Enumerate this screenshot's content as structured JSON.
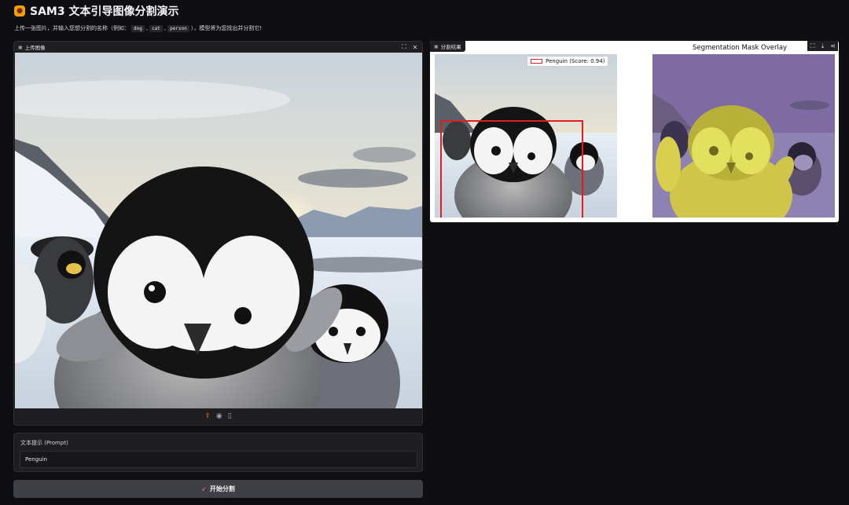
{
  "header": {
    "title": "SAM3 文本引导图像分割演示",
    "logo_icon": "panda-icon"
  },
  "subtitle": {
    "prefix": "上传一张图片，并输入您想分割的名称（例如：",
    "examples": [
      "dog",
      "cat",
      "person"
    ],
    "separator": ",",
    "suffix": "），模型将为您找出并分割它!"
  },
  "upload_panel": {
    "label": "上传图像",
    "label_icon": "image-icon",
    "tools": [
      "fullscreen-icon",
      "close-icon"
    ],
    "bar_icons": [
      "upload-icon",
      "webcam-icon",
      "clipboard-icon"
    ]
  },
  "result_panel": {
    "label": "分割结果",
    "label_icon": "image-icon",
    "tools": [
      "fullscreen-icon",
      "download-icon",
      "share-icon"
    ],
    "legend_label": "Penguin (Score: 0.94)",
    "overlay_title": "Segmentation Mask Overlay"
  },
  "prompt": {
    "label": "文本提示 (Prompt)",
    "value": "Penguin"
  },
  "run_button": {
    "label": "开始分割",
    "icon": "rocket-icon"
  },
  "colors": {
    "background": "#0f0f11",
    "panel": "#1f1f22",
    "bbox": "#e11d1d",
    "mask": "#e5e54a",
    "button": "#3f3f46"
  }
}
